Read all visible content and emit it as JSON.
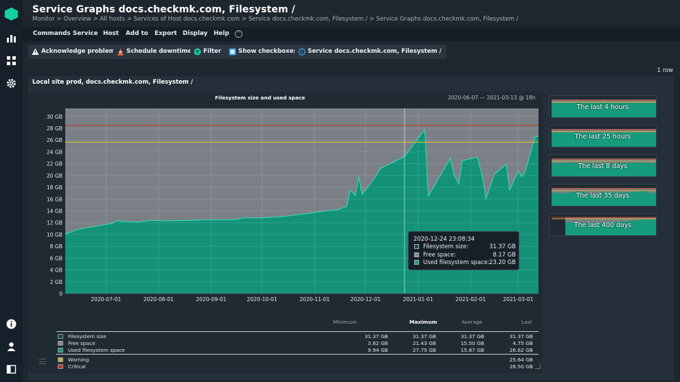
{
  "header": {
    "title": "Service Graphs docs.checkmk.com, Filesystem /",
    "breadcrumb": "Monitor > Overview > All hosts > Services of Host docs.checkmk.com > Service docs.checkmk.com, Filesystem / > Service Graphs docs.checkmk.com, Filesystem /"
  },
  "menu": [
    "Commands",
    "Service",
    "Host",
    "Add to",
    "Export",
    "Display",
    "Help"
  ],
  "toolbar": {
    "acknowledge": "Acknowledge problems",
    "downtime": "Schedule downtimes",
    "filter": "Filter",
    "checkboxes": "Show checkboxes",
    "service": "Service docs.checkmk.com, Filesystem /"
  },
  "row_count": "1 row",
  "panel_title": "Local site prod, docs.checkmk.com, Filesystem /",
  "graph": {
    "title": "Filesystem size and used space",
    "range": "2020-06-07 — 2021-03-13 @ 18h"
  },
  "tooltip": {
    "time": "2020-12-24 23:08:34",
    "rows": [
      {
        "label": "Filesystem size:",
        "value": "31.37 GB",
        "color": "#1a4a3e"
      },
      {
        "label": "Free space:",
        "value": "8.17 GB",
        "color": "#8a8f95"
      },
      {
        "label": "Used filesystem space:",
        "value": "23.20 GB",
        "color": "#1f9c7c"
      }
    ]
  },
  "legend": {
    "headers": {
      "min": "Minimum",
      "max": "Maximum",
      "avg": "Average",
      "last": "Last"
    },
    "rows": [
      {
        "label": "Filesystem size",
        "min": "31.37 GB",
        "max": "31.37 GB",
        "avg": "31.37 GB",
        "last": "31.37 GB",
        "color": "#1a4a3e"
      },
      {
        "label": "Free space",
        "min": "3.62 GB",
        "max": "21.43 GB",
        "avg": "15.50 GB",
        "last": "4.75 GB",
        "color": "#8a8f95"
      },
      {
        "label": "Used filesystem space",
        "min": "9.94 GB",
        "max": "27.75 GB",
        "avg": "15.87 GB",
        "last": "26.62 GB",
        "color": "#1f9c7c"
      }
    ],
    "thresholds": [
      {
        "label": "Warning",
        "value": "25.64 GB",
        "color": "#c8b43a"
      },
      {
        "label": "Critical",
        "value": "28.50 GB",
        "color": "#c0392b"
      }
    ]
  },
  "thumbnails": [
    "The last 4 hours",
    "The last 25 hours",
    "The last 8 days",
    "The last 35 days",
    "The last 400 days"
  ],
  "chart_data": {
    "type": "area",
    "title": "Filesystem size and used space",
    "y_ticks": [
      "0",
      "2 GB",
      "4 GB",
      "6 GB",
      "8 GB",
      "10 GB",
      "12 GB",
      "14 GB",
      "16 GB",
      "18 GB",
      "20 GB",
      "22 GB",
      "24 GB",
      "26 GB",
      "28 GB",
      "30 GB"
    ],
    "x_ticks": [
      "2020-07-01",
      "2020-08-01",
      "2020-09-01",
      "2020-10-01",
      "2020-11-01",
      "2020-12-01",
      "2021-01-01",
      "2021-02-01",
      "2021-03-01"
    ],
    "ylim": [
      0,
      31.37
    ],
    "xlim": [
      "2020-06-07",
      "2021-03-13"
    ],
    "warning": 25.64,
    "critical": 28.5,
    "filesystem_size": 31.37,
    "used_series": {
      "name": "Used filesystem space",
      "x": [
        "2020-06-07",
        "2020-06-15",
        "2020-06-25",
        "2020-07-05",
        "2020-07-07",
        "2020-07-20",
        "2020-07-27",
        "2020-08-05",
        "2020-08-20",
        "2020-09-01",
        "2020-09-15",
        "2020-09-20",
        "2020-10-01",
        "2020-10-15",
        "2020-11-01",
        "2020-11-10",
        "2020-11-15",
        "2020-11-20",
        "2020-11-22",
        "2020-11-25",
        "2020-11-27",
        "2020-11-29",
        "2020-12-05",
        "2020-12-10",
        "2020-12-24",
        "2021-01-01",
        "2021-01-05",
        "2021-01-07",
        "2021-01-20",
        "2021-01-22",
        "2021-01-25",
        "2021-01-27",
        "2021-02-05",
        "2021-02-08",
        "2021-02-10",
        "2021-02-15",
        "2021-02-22",
        "2021-02-24",
        "2021-03-01",
        "2021-03-03",
        "2021-03-05",
        "2021-03-09",
        "2021-03-11",
        "2021-03-13"
      ],
      "values": [
        10.1,
        10.9,
        11.4,
        11.9,
        12.3,
        12.1,
        12.4,
        12.3,
        12.4,
        12.5,
        12.5,
        12.8,
        12.8,
        13.1,
        13.7,
        14.1,
        14.2,
        14.8,
        17.5,
        16.6,
        19.8,
        16.8,
        19.0,
        21.2,
        23.2,
        26.3,
        27.75,
        16.5,
        22.9,
        20.3,
        18.5,
        22.5,
        23.1,
        19.8,
        16.0,
        20.2,
        21.9,
        17.5,
        20.8,
        19.8,
        20.5,
        24.5,
        26.6,
        26.62
      ]
    }
  }
}
